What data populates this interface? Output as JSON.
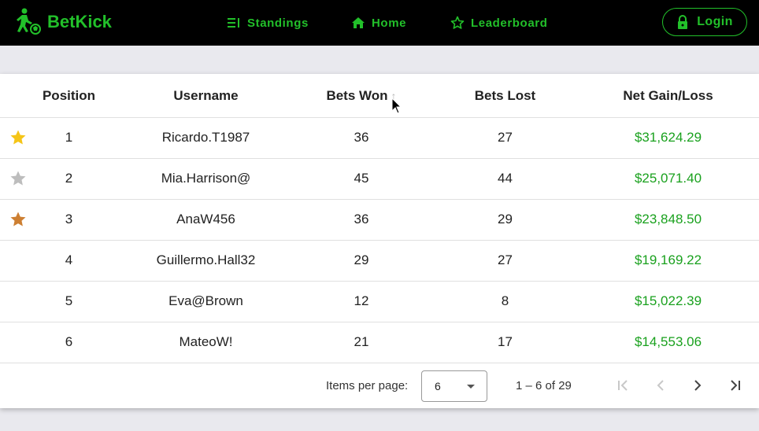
{
  "brand": {
    "name": "BetKick",
    "icon": "soccer-player-icon"
  },
  "nav": {
    "standings": {
      "label": "Standings",
      "icon": "list-icon"
    },
    "home": {
      "label": "Home",
      "icon": "home-icon"
    },
    "leaderboard": {
      "label": "Leaderboard",
      "icon": "star-outline-icon"
    }
  },
  "login": {
    "label": "Login",
    "icon": "lock-icon"
  },
  "colors": {
    "accent": "#22c02a",
    "gain": "#1aa11e",
    "gold": "#f5c518",
    "silver": "#bdbdbd",
    "bronze": "#cd7f32"
  },
  "table": {
    "headers": {
      "position": "Position",
      "username": "Username",
      "bets_won": "Bets Won",
      "bets_lost": "Bets Lost",
      "net": "Net Gain/Loss"
    },
    "rows": [
      {
        "medal": "gold",
        "position": "1",
        "username": "Ricardo.T1987",
        "bets_won": "36",
        "bets_lost": "27",
        "net": "$31,624.29"
      },
      {
        "medal": "silver",
        "position": "2",
        "username": "Mia.Harrison@",
        "bets_won": "45",
        "bets_lost": "44",
        "net": "$25,071.40"
      },
      {
        "medal": "bronze",
        "position": "3",
        "username": "AnaW456",
        "bets_won": "36",
        "bets_lost": "29",
        "net": "$23,848.50"
      },
      {
        "medal": "",
        "position": "4",
        "username": "Guillermo.Hall32",
        "bets_won": "29",
        "bets_lost": "27",
        "net": "$19,169.22"
      },
      {
        "medal": "",
        "position": "5",
        "username": "Eva@Brown",
        "bets_won": "12",
        "bets_lost": "8",
        "net": "$15,022.39"
      },
      {
        "medal": "",
        "position": "6",
        "username": "MateoW!",
        "bets_won": "21",
        "bets_lost": "17",
        "net": "$14,553.06"
      }
    ]
  },
  "paginator": {
    "items_per_page_label": "Items per page:",
    "items_per_page_value": "6",
    "range": "1 – 6 of 29"
  }
}
